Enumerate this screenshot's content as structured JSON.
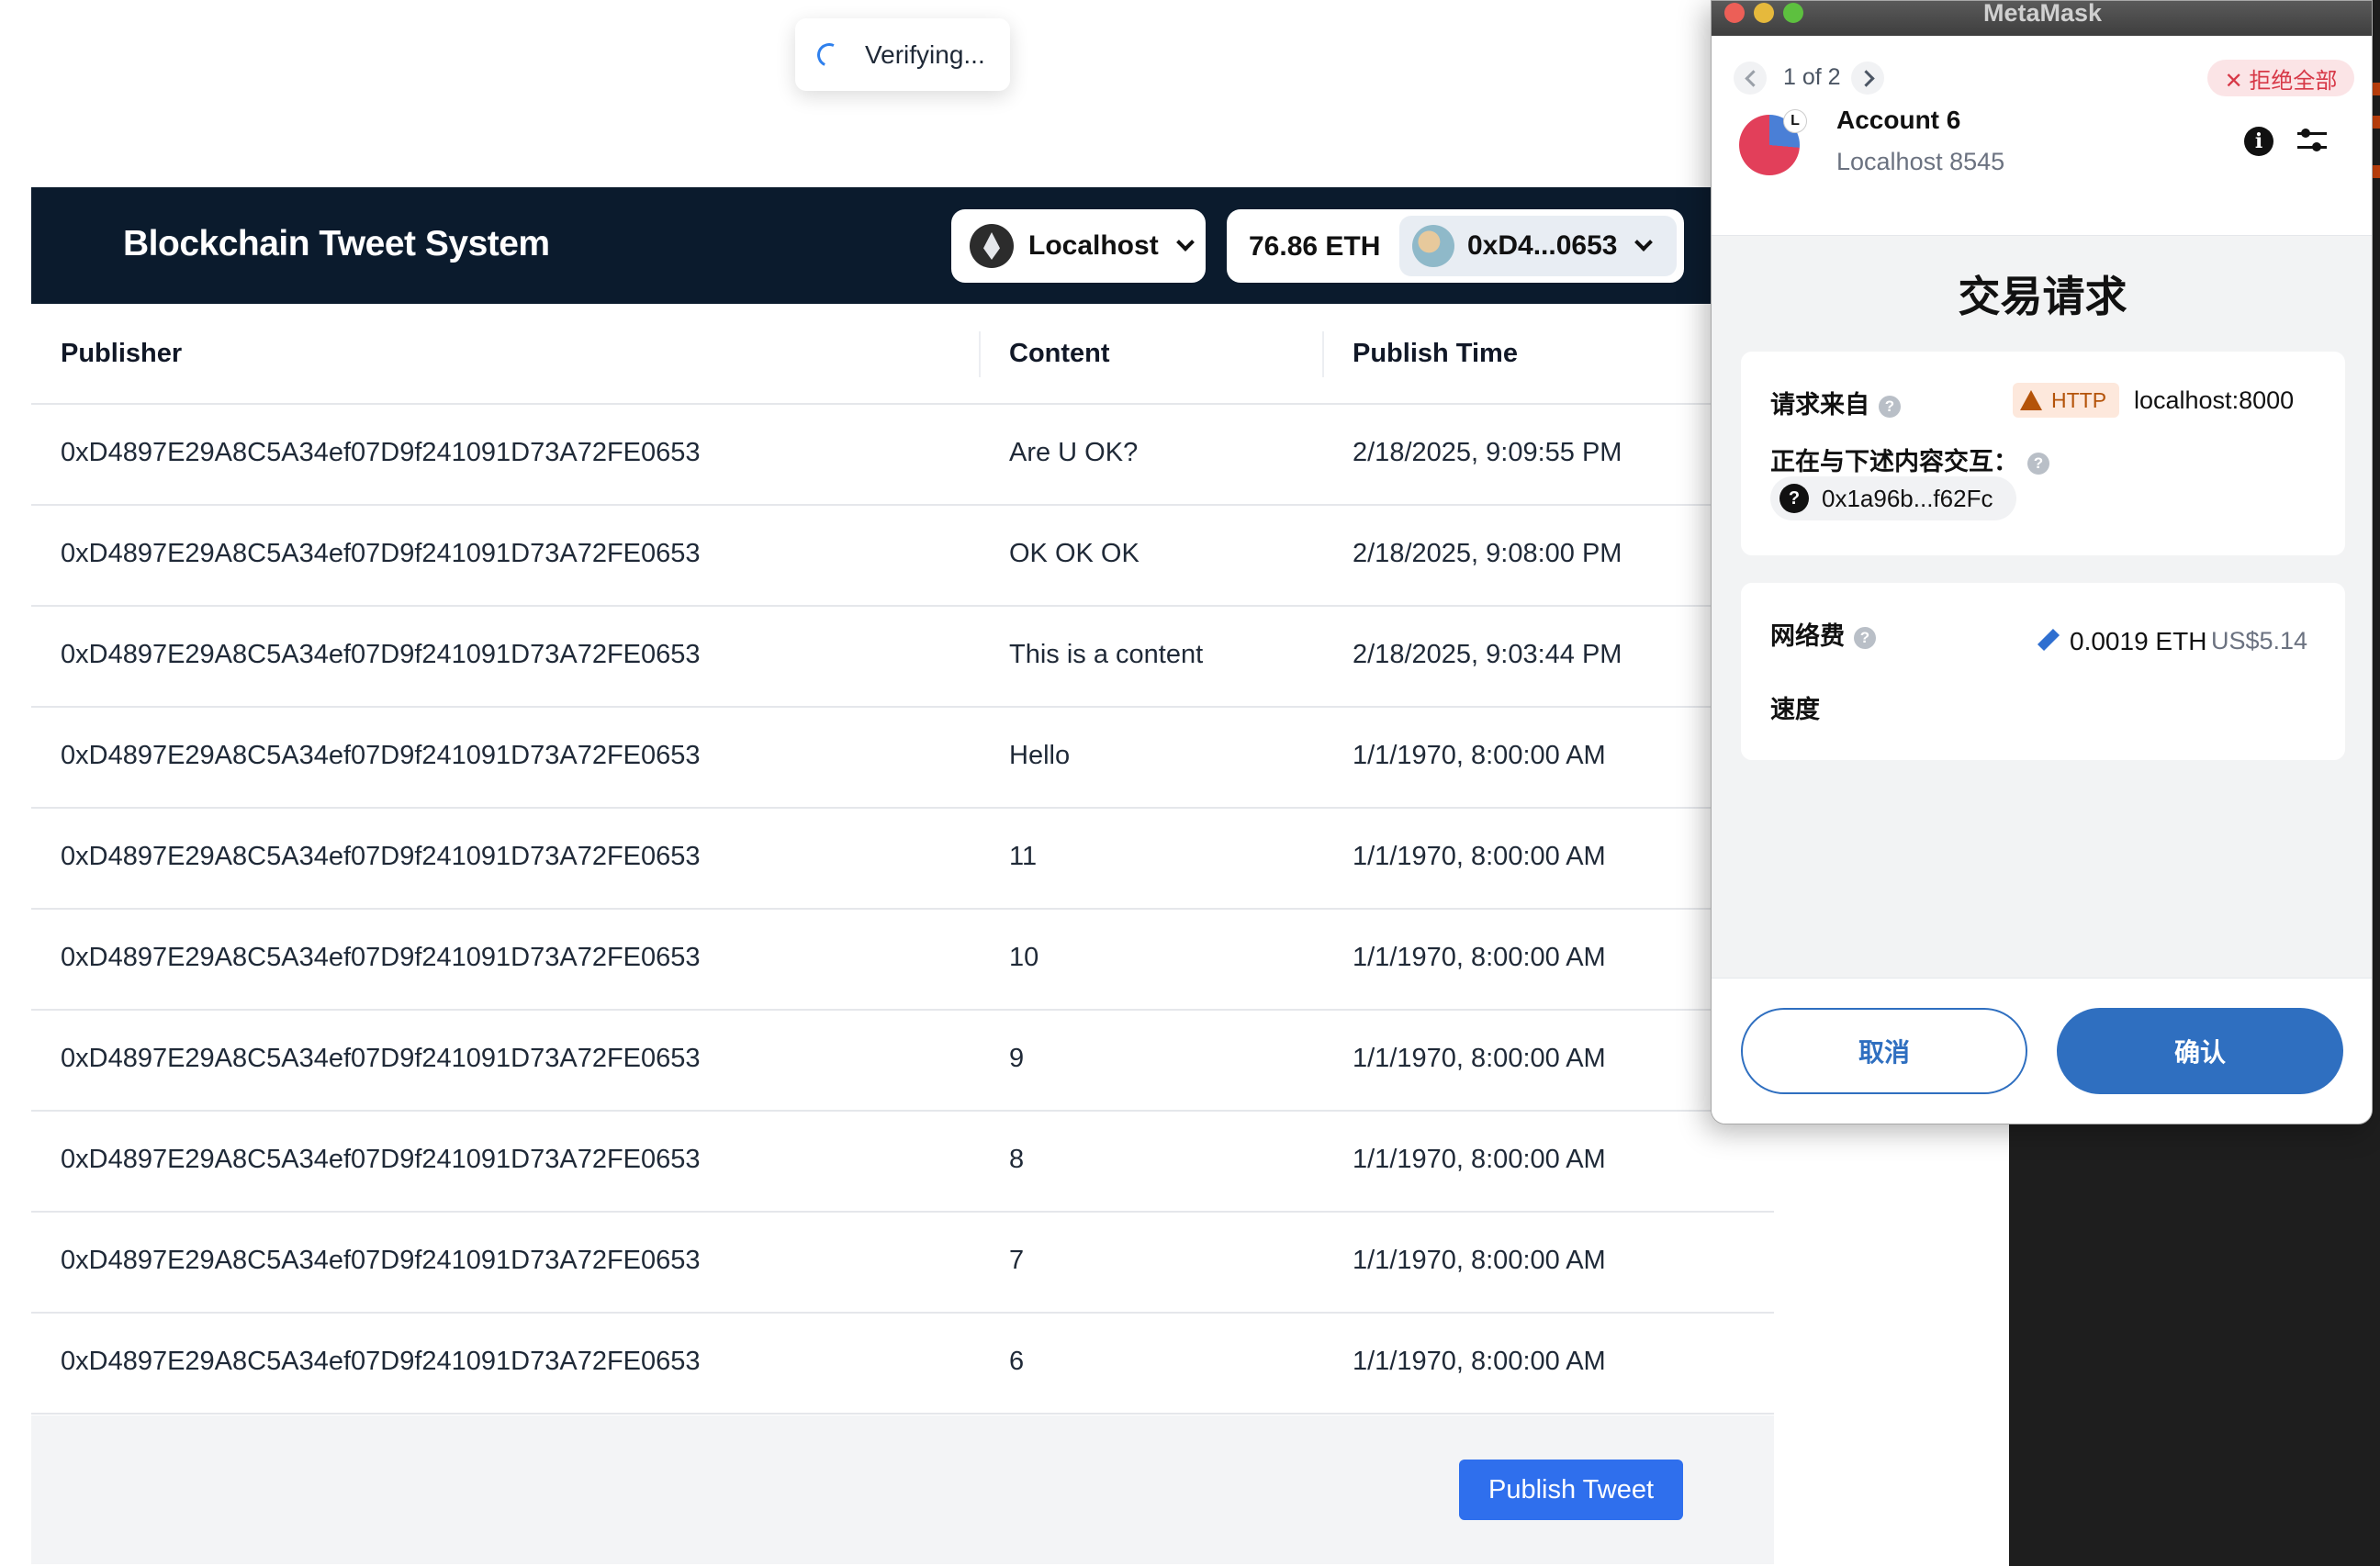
{
  "toast": {
    "text": "Verifying..."
  },
  "header": {
    "title": "Blockchain Tweet System",
    "network": "Localhost",
    "balance": "76.86 ETH",
    "account": "0xD4...0653"
  },
  "table": {
    "columns": [
      "Publisher",
      "Content",
      "Publish Time"
    ],
    "rows": [
      [
        "0xD4897E29A8C5A34ef07D9f241091D73A72FE0653",
        "Are U OK?",
        "2/18/2025, 9:09:55 PM"
      ],
      [
        "0xD4897E29A8C5A34ef07D9f241091D73A72FE0653",
        "OK OK OK",
        "2/18/2025, 9:08:00 PM"
      ],
      [
        "0xD4897E29A8C5A34ef07D9f241091D73A72FE0653",
        "This is a content",
        "2/18/2025, 9:03:44 PM"
      ],
      [
        "0xD4897E29A8C5A34ef07D9f241091D73A72FE0653",
        "Hello",
        "1/1/1970, 8:00:00 AM"
      ],
      [
        "0xD4897E29A8C5A34ef07D9f241091D73A72FE0653",
        "11",
        "1/1/1970, 8:00:00 AM"
      ],
      [
        "0xD4897E29A8C5A34ef07D9f241091D73A72FE0653",
        "10",
        "1/1/1970, 8:00:00 AM"
      ],
      [
        "0xD4897E29A8C5A34ef07D9f241091D73A72FE0653",
        "9",
        "1/1/1970, 8:00:00 AM"
      ],
      [
        "0xD4897E29A8C5A34ef07D9f241091D73A72FE0653",
        "8",
        "1/1/1970, 8:00:00 AM"
      ],
      [
        "0xD4897E29A8C5A34ef07D9f241091D73A72FE0653",
        "7",
        "1/1/1970, 8:00:00 AM"
      ],
      [
        "0xD4897E29A8C5A34ef07D9f241091D73A72FE0653",
        "6",
        "1/1/1970, 8:00:00 AM"
      ]
    ]
  },
  "footer": {
    "publish_label": "Publish Tweet"
  },
  "metamask": {
    "window_title": "MetaMask",
    "page_indicator": "1 of 2",
    "reject_all": "✕ 拒绝全部",
    "account_name": "Account 6",
    "account_network": "Localhost 8545",
    "avatar_letter": "L",
    "heading": "交易请求",
    "request_from_label": "请求来自",
    "http_badge": "HTTP",
    "origin": "localhost:8000",
    "interacting_label": "正在与下述内容交互：",
    "contract_address": "0x1a96b...f62Fc",
    "network_fee_label": "网络费",
    "fee_eth": "0.0019 ETH",
    "fee_usd": "US$5.14",
    "speed_label": "速度",
    "cancel_label": "取消",
    "confirm_label": "确认"
  },
  "colors": {
    "header_bg": "#0b1b2d",
    "publish_button": "#2f6fed",
    "metamask_primary": "#2f6fc0",
    "reject_red": "#d73847",
    "http_warning": "#b45309"
  },
  "icons": [
    "spinner-icon",
    "ethereum-icon",
    "chevron-down-icon",
    "account-avatar-icon",
    "chevron-left-icon",
    "chevron-right-icon",
    "close-icon",
    "info-icon",
    "settings-sliders-icon",
    "question-icon",
    "warning-icon",
    "edit-pencil-icon"
  ]
}
